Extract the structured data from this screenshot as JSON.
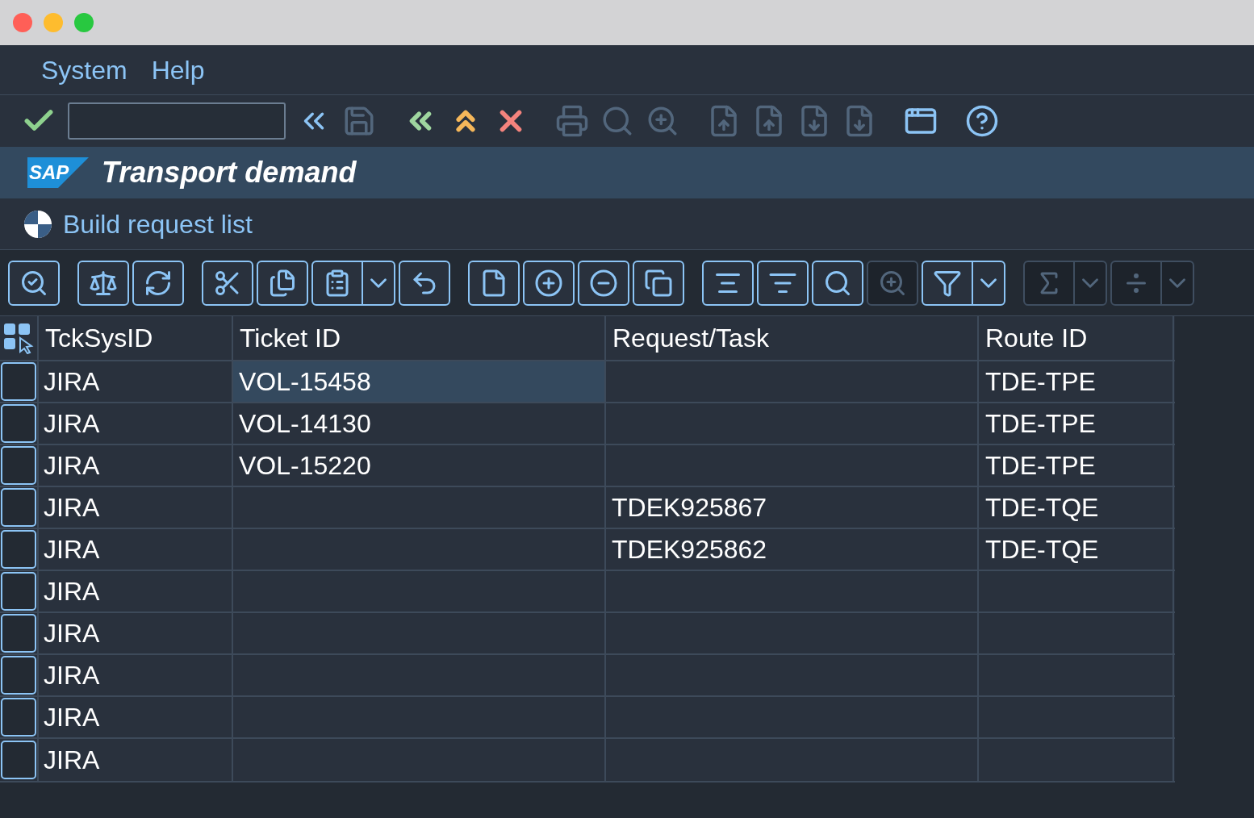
{
  "menu": [
    {
      "label": "System"
    },
    {
      "label": "Help"
    }
  ],
  "system_toolbar": {
    "buttons": [
      {
        "disabled": false
      },
      {
        "disabled": false
      },
      {
        "disabled": true
      },
      {
        "disabled": false
      },
      {
        "disabled": false
      },
      {
        "disabled": false
      },
      {
        "disabled": true
      },
      {
        "disabled": true
      },
      {
        "disabled": true
      },
      {
        "disabled": true
      },
      {
        "disabled": true
      },
      {
        "disabled": true
      },
      {
        "disabled": true
      },
      {
        "disabled": false
      },
      {
        "disabled": false
      }
    ]
  },
  "title_bar": {
    "logo": "SAP",
    "title": "Transport demand"
  },
  "subtitle": "Build request list",
  "app_toolbar": {
    "groups": [
      [
        {
          "disabled": false,
          "has_menu": false
        }
      ],
      [
        {
          "disabled": false,
          "has_menu": false
        },
        {
          "disabled": false,
          "has_menu": false
        }
      ],
      [
        {
          "disabled": false,
          "has_menu": false
        },
        {
          "disabled": false,
          "has_menu": false
        },
        {
          "disabled": false,
          "has_menu": true
        },
        {
          "disabled": false,
          "has_menu": false
        }
      ],
      [
        {
          "disabled": false,
          "has_menu": false
        },
        {
          "disabled": false,
          "has_menu": false
        },
        {
          "disabled": false,
          "has_menu": false
        },
        {
          "disabled": false,
          "has_menu": false
        }
      ],
      [
        {
          "disabled": false,
          "has_menu": false
        },
        {
          "disabled": false,
          "has_menu": false
        },
        {
          "disabled": false,
          "has_menu": false
        },
        {
          "disabled": true,
          "has_menu": false
        },
        {
          "disabled": false,
          "has_menu": true
        }
      ],
      [
        {
          "disabled": true,
          "has_menu": true
        },
        {
          "disabled": true,
          "has_menu": true
        }
      ]
    ]
  },
  "table": {
    "columns": [
      "TckSysID",
      "Ticket ID",
      "Request/Task",
      "Route ID"
    ],
    "rows": [
      {
        "selected": false,
        "tck_sys_id": "JIRA",
        "ticket_id": "VOL-15458",
        "ticket_id_focused": true,
        "route_id": "TDE-TPE"
      },
      {
        "selected": false,
        "tck_sys_id": "JIRA",
        "ticket_id": "VOL-14130",
        "ticket_id_focused": false,
        "route_id": "TDE-TPE"
      },
      {
        "selected": false,
        "tck_sys_id": "JIRA",
        "ticket_id": "VOL-15220",
        "ticket_id_focused": false,
        "route_id": "TDE-TPE"
      },
      {
        "selected": false,
        "tck_sys_id": "JIRA",
        "request_task": "TDEK925867",
        "route_id": "TDE-TQE"
      },
      {
        "selected": false,
        "tck_sys_id": "JIRA",
        "request_task": "TDEK925862",
        "route_id": "TDE-TQE"
      },
      {
        "selected": false,
        "tck_sys_id": "JIRA"
      },
      {
        "selected": false,
        "tck_sys_id": "JIRA"
      },
      {
        "selected": false,
        "tck_sys_id": "JIRA"
      },
      {
        "selected": false,
        "tck_sys_id": "JIRA"
      },
      {
        "selected": false,
        "tck_sys_id": "JIRA"
      }
    ]
  }
}
